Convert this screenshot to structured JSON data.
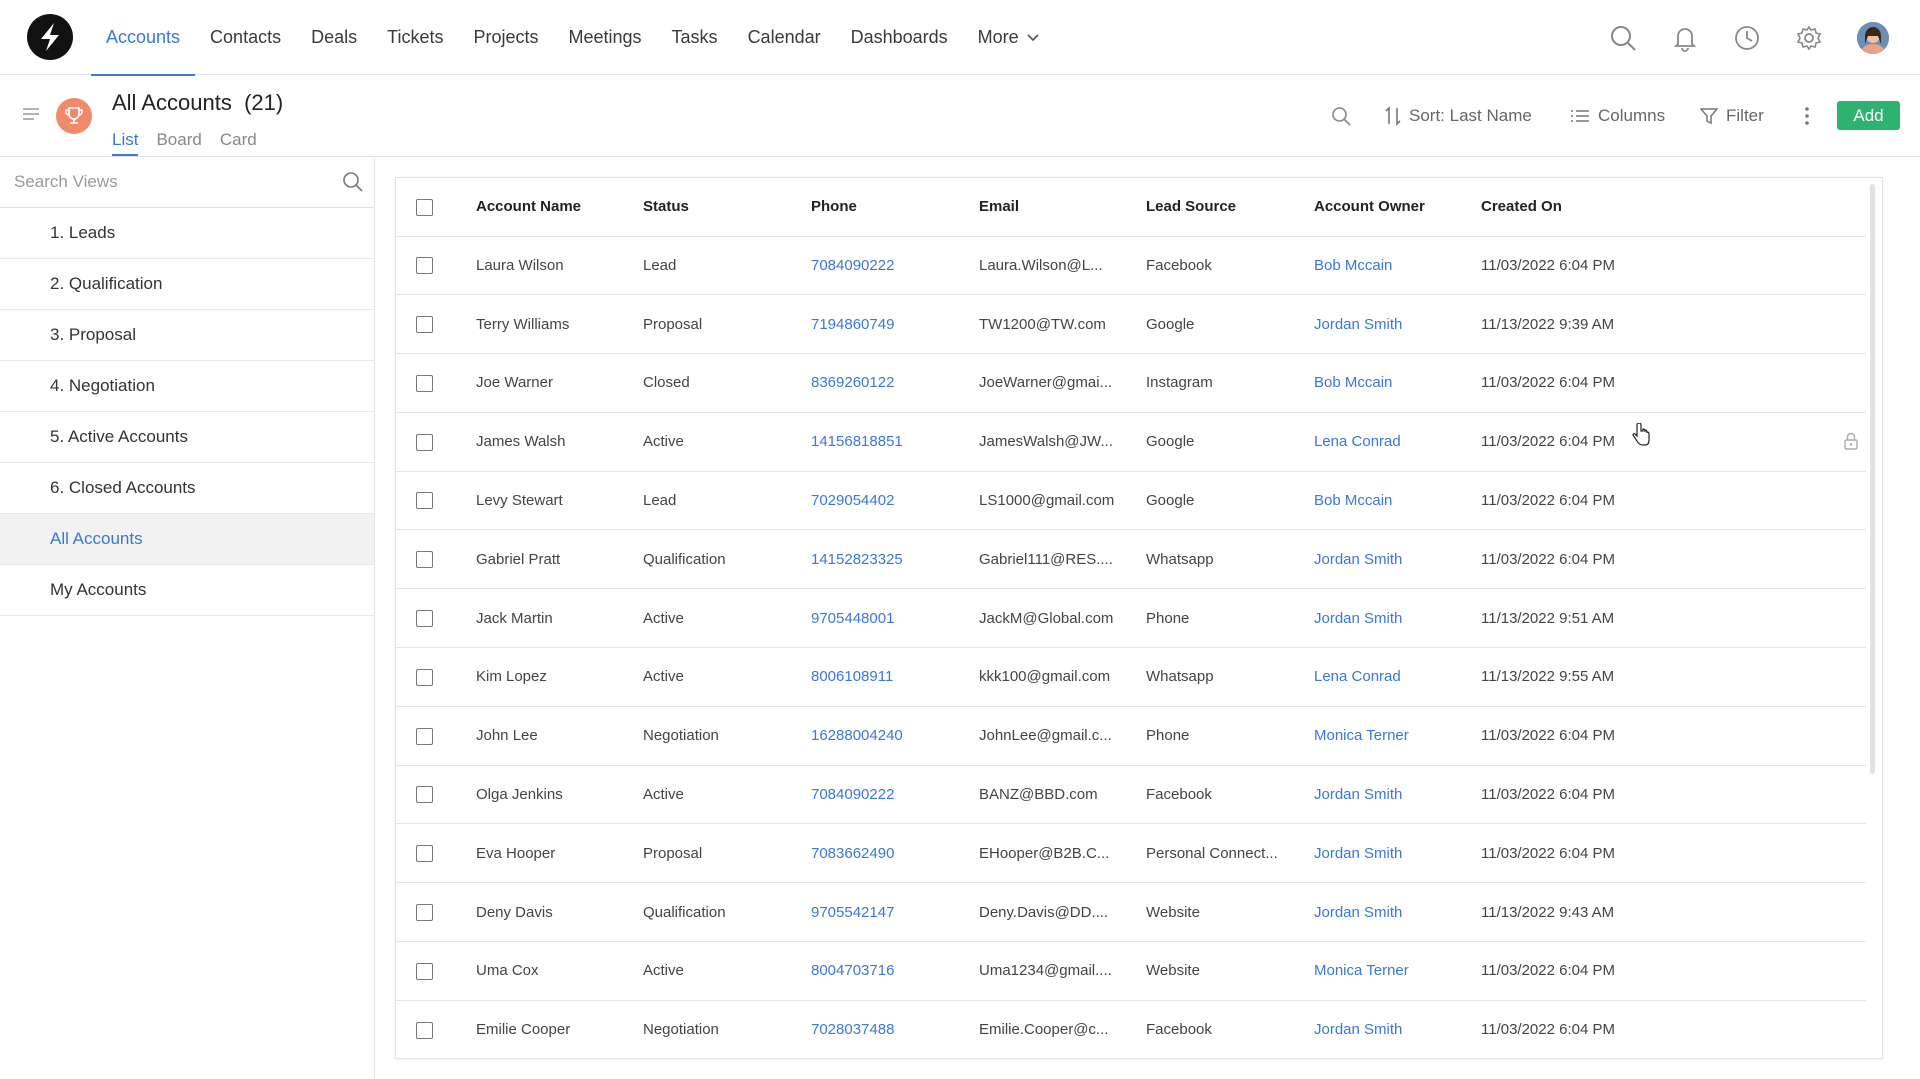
{
  "nav": {
    "items": [
      "Accounts",
      "Contacts",
      "Deals",
      "Tickets",
      "Projects",
      "Meetings",
      "Tasks",
      "Calendar",
      "Dashboards"
    ],
    "more_label": "More",
    "icons": [
      "search-icon",
      "bell-icon",
      "clock-icon",
      "gear-icon",
      "avatar"
    ]
  },
  "header": {
    "title": "All Accounts",
    "count": "(21)",
    "view_tabs": [
      "List",
      "Board",
      "Card"
    ],
    "active_tab": "List",
    "sort_label": "Sort: Last Name",
    "columns_label": "Columns",
    "filter_label": "Filter",
    "add_label": "Add"
  },
  "sidebar": {
    "search_placeholder": "Search Views",
    "views": [
      "1. Leads",
      "2. Qualification",
      "3. Proposal",
      "4. Negotiation",
      "5. Active Accounts",
      "6. Closed Accounts",
      "All Accounts",
      "My Accounts"
    ],
    "selected": "All Accounts"
  },
  "table": {
    "columns": [
      "Account Name",
      "Status",
      "Phone",
      "Email",
      "Lead Source",
      "Account Owner",
      "Created On"
    ],
    "rows": [
      [
        "Laura Wilson",
        "Lead",
        "7084090222",
        "Laura.Wilson@L...",
        "Facebook",
        "Bob Mccain",
        "11/03/2022 6:04 PM"
      ],
      [
        "Terry Williams",
        "Proposal",
        "7194860749",
        "TW1200@TW.com",
        "Google",
        "Jordan Smith",
        "11/13/2022 9:39 AM"
      ],
      [
        "Joe Warner",
        "Closed",
        "8369260122",
        "JoeWarner@gmai...",
        "Instagram",
        "Bob Mccain",
        "11/03/2022 6:04 PM"
      ],
      [
        "James Walsh",
        "Active",
        "14156818851",
        "JamesWalsh@JW...",
        "Google",
        "Lena Conrad",
        "11/03/2022 6:04 PM"
      ],
      [
        "Levy Stewart",
        "Lead",
        "7029054402",
        "LS1000@gmail.com",
        "Google",
        "Bob Mccain",
        "11/03/2022 6:04 PM"
      ],
      [
        "Gabriel Pratt",
        "Qualification",
        "14152823325",
        "Gabriel111@RES....",
        "Whatsapp",
        "Jordan Smith",
        "11/03/2022 6:04 PM"
      ],
      [
        "Jack Martin",
        "Active",
        "9705448001",
        "JackM@Global.com",
        "Phone",
        "Jordan Smith",
        "11/13/2022 9:51 AM"
      ],
      [
        "Kim Lopez",
        "Active",
        "8006108911",
        "kkk100@gmail.com",
        "Whatsapp",
        "Lena Conrad",
        "11/13/2022 9:55 AM"
      ],
      [
        "John Lee",
        "Negotiation",
        "16288004240",
        "JohnLee@gmail.c...",
        "Phone",
        "Monica Terner",
        "11/03/2022 6:04 PM"
      ],
      [
        "Olga Jenkins",
        "Active",
        "7084090222",
        "BANZ@BBD.com",
        "Facebook",
        "Jordan Smith",
        "11/03/2022 6:04 PM"
      ],
      [
        "Eva Hooper",
        "Proposal",
        "7083662490",
        "EHooper@B2B.C...",
        "Personal Connect...",
        "Jordan Smith",
        "11/03/2022 6:04 PM"
      ],
      [
        "Deny Davis",
        "Qualification",
        "9705542147",
        "Deny.Davis@DD....",
        "Website",
        "Jordan Smith",
        "11/13/2022 9:43 AM"
      ],
      [
        "Uma Cox",
        "Active",
        "8004703716",
        "Uma1234@gmail....",
        "Website",
        "Monica Terner",
        "11/03/2022 6:04 PM"
      ],
      [
        "Emilie Cooper",
        "Negotiation",
        "7028037488",
        "Emilie.Cooper@c...",
        "Facebook",
        "Jordan Smith",
        "11/03/2022 6:04 PM"
      ]
    ]
  },
  "colors": {
    "accent": "#3a78d8",
    "add_button": "#2db36f",
    "trophy_badge": "#f08a6a"
  }
}
